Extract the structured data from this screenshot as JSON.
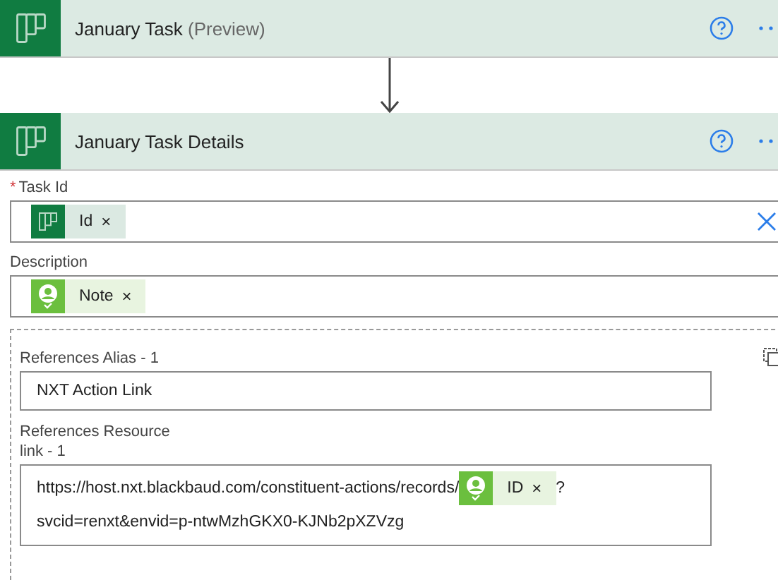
{
  "cards": [
    {
      "title": "January Task",
      "suffix": "(Preview)"
    },
    {
      "title": "January Task Details"
    }
  ],
  "fields": [
    {
      "label": "Task Id",
      "required": true,
      "required_mark": "*",
      "clearable": true,
      "tokens": [
        {
          "kind": "planner",
          "text": "Id",
          "remove": "×"
        }
      ]
    },
    {
      "label": "Description",
      "required": false,
      "clearable": false,
      "tokens": [
        {
          "kind": "person",
          "text": "Note",
          "remove": "×"
        }
      ]
    }
  ],
  "reference": {
    "alias_label": "References Alias - 1",
    "alias_value": "NXT Action Link",
    "resource_label": "References Resource link - 1",
    "resource_parts": [
      {
        "kind": "text",
        "text": "https://host.nxt.blackbaud.com/constituent-actions/records/"
      },
      {
        "kind": "person",
        "text": "ID",
        "remove": "×"
      },
      {
        "kind": "text",
        "text": "?"
      },
      {
        "kind": "line",
        "text": "svcid=renxt&envid=p-ntwMzhGKX0-KJNb2pXZVzg"
      }
    ]
  }
}
